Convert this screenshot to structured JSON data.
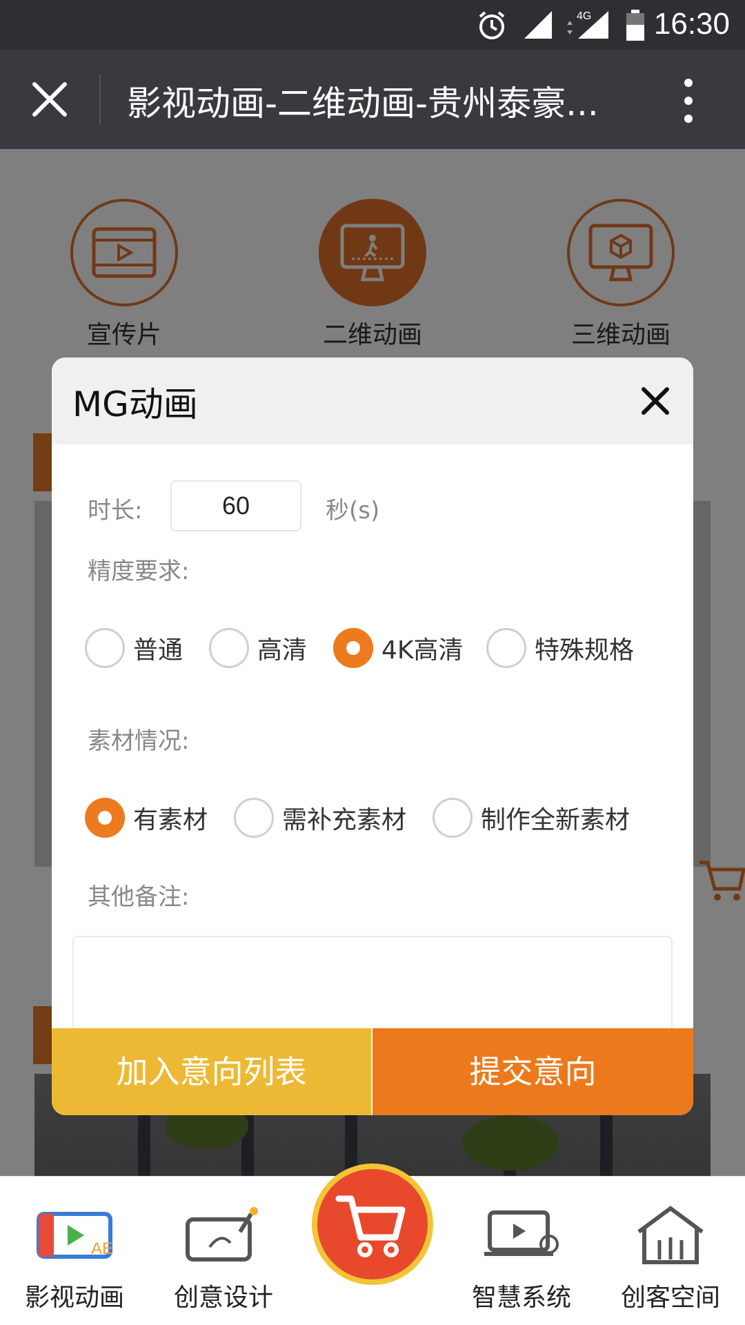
{
  "status_bar": {
    "time": "16:30",
    "network": "4G",
    "icons": [
      "alarm-icon",
      "signal-icon",
      "signal-4g-icon",
      "battery-icon"
    ]
  },
  "title_bar": {
    "title": "影视动画-二维动画-贵州泰豪...",
    "icons": [
      "close-icon",
      "more-vertical-icon"
    ]
  },
  "categories": [
    {
      "label": "宣传片",
      "icon": "film-icon",
      "active": false
    },
    {
      "label": "二维动画",
      "icon": "monitor-animation-icon",
      "active": true
    },
    {
      "label": "三维动画",
      "icon": "monitor-3d-icon",
      "active": false
    }
  ],
  "dialog": {
    "title": "MG动画",
    "duration": {
      "label": "时长:",
      "value": "60",
      "unit": "秒(s)"
    },
    "precision": {
      "label": "精度要求:",
      "options": [
        "普通",
        "高清",
        "4K高清",
        "特殊规格"
      ],
      "selected": "4K高清"
    },
    "material": {
      "label": "素材情况:",
      "options": [
        "有素材",
        "需补充素材",
        "制作全新素材"
      ],
      "selected": "有素材"
    },
    "notes": {
      "label": "其他备注:",
      "value": ""
    },
    "buttons": {
      "add_to_list": "加入意向列表",
      "submit": "提交意向"
    }
  },
  "bottom_nav": {
    "items": [
      {
        "label": "影视动画",
        "icon": "film-animation-icon"
      },
      {
        "label": "创意设计",
        "icon": "design-tablet-icon"
      },
      {
        "label": "智慧系统",
        "icon": "smart-system-icon"
      },
      {
        "label": "创客空间",
        "icon": "maker-space-icon"
      }
    ],
    "center": {
      "icon": "shopping-cart-icon"
    }
  },
  "colors": {
    "accent": "#ec7a1c",
    "accent_yellow": "#edb934",
    "topbar": "#393a3f",
    "status_bar": "#2e2f33"
  }
}
